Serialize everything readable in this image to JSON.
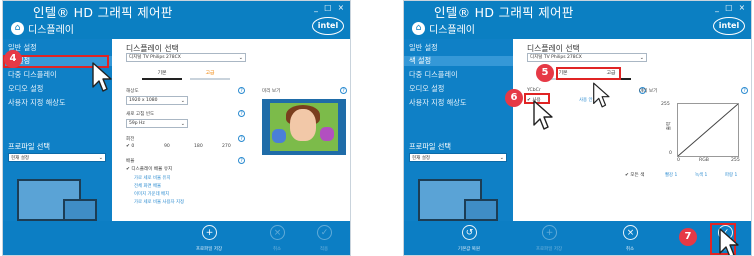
{
  "app": {
    "title": "인텔® HD 그래픽 제어판",
    "section": "디스플레이",
    "window_controls": "_ □ ×",
    "logo": "intel"
  },
  "sidebar": {
    "items": [
      {
        "label": "일반 설정"
      },
      {
        "label": "색 설정"
      },
      {
        "label": "다중 디스플레이"
      },
      {
        "label": "오디오 설정"
      },
      {
        "label": "사용자 지정 해상도"
      }
    ],
    "profile_title": "프로파일 선택",
    "profile_value": "현재 설정"
  },
  "left": {
    "display_select_title": "디스플레이 선택",
    "display_value": "디지털 TV Philips 278CX",
    "tabs": [
      "기본",
      "고급"
    ],
    "resolution_label": "해상도",
    "resolution_value": "1920 x 1080",
    "refresh_label": "새로 고침 빈도",
    "refresh_value": "59p Hz",
    "rotation_label": "회전",
    "rotation_options": [
      "0",
      "90",
      "180",
      "270"
    ],
    "preview_label": "미리 보기",
    "scale_label": "배율",
    "scale_option_checked": "디스플레이 배율 유지",
    "scale_links": [
      "가로 세로 비율 유지",
      "전체 화면 배율",
      "이미지 가운데 배치",
      "가로 세로 비율 사용자 지정"
    ],
    "footer": [
      {
        "icon": "plus",
        "label": "프로파일 저장",
        "enabled": true
      },
      {
        "icon": "x",
        "label": "취소",
        "enabled": false
      },
      {
        "icon": "check",
        "label": "적용",
        "enabled": false
      }
    ]
  },
  "right": {
    "display_select_title": "디스플레이 선택",
    "display_value": "디지털 TV Philips 278CX",
    "tabs": [
      "기본",
      "고급"
    ],
    "ycbcr_label": "YCbCr",
    "ycbcr_checked": "사용",
    "ycbcr_extra": "사용 안 함",
    "preview_label": "미리 보기",
    "graph_y_values": [
      "255",
      "0"
    ],
    "graph_y_label": "출력",
    "graph_x_values": [
      "0",
      "RGB",
      "255"
    ],
    "channel_options": [
      "✔ 모든 색",
      "빨강 1",
      "녹색 1",
      "파랑 1"
    ],
    "footer": [
      {
        "icon": "restore",
        "label": "기본값 복원",
        "enabled": true
      },
      {
        "icon": "plus",
        "label": "프로파일 저장",
        "enabled": false
      },
      {
        "icon": "x",
        "label": "취소",
        "enabled": true
      },
      {
        "icon": "check",
        "label": "적용",
        "enabled": true
      }
    ]
  },
  "steps": {
    "step4": "4",
    "step5": "5",
    "step6": "6",
    "step7": "7"
  },
  "colors": {
    "header_blue": "#0b7fc2",
    "highlight_red": "#e02424",
    "badge_red": "#e63946"
  }
}
